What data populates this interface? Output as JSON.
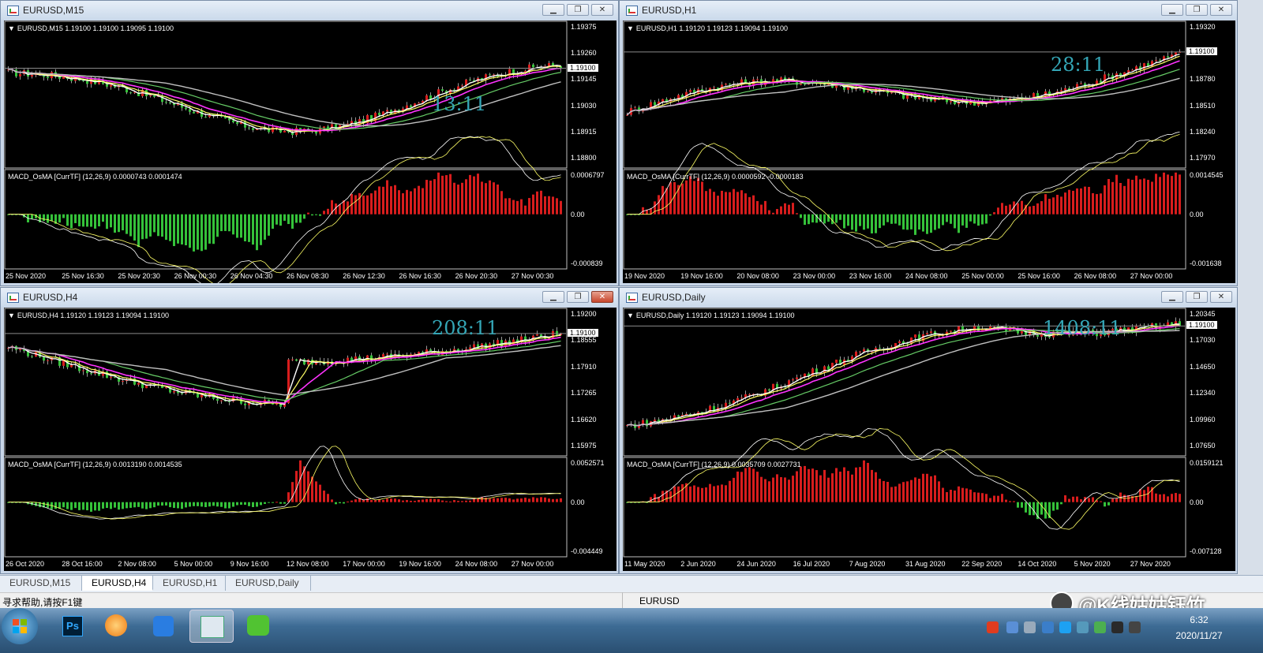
{
  "windows": [
    {
      "title": "EURUSD,M15",
      "header": "EURUSD,M15  1.19100 1.19100 1.19095 1.19100",
      "timer": "13:11",
      "price_labels": [
        "1.19375",
        "1.19260",
        "1.19145",
        "1.19030",
        "1.18915",
        "1.18800"
      ],
      "current": "1.19100",
      "indicator": "MACD_OsMA [CurrTF] (12,26,9) 0.0000743 0.0001474",
      "ind_top": "0.0006797",
      "ind_zero": "0.00",
      "ind_bottom": "-0.000839",
      "time_labels": [
        "25 Nov 2020",
        "25 Nov 16:30",
        "25 Nov 20:30",
        "26 Nov 00:30",
        "26 Nov 04:30",
        "26 Nov 08:30",
        "26 Nov 12:30",
        "26 Nov 16:30",
        "26 Nov 20:30",
        "27 Nov 00:30"
      ]
    },
    {
      "title": "EURUSD,H1",
      "header": "EURUSD,H1  1.19120 1.19123 1.19094 1.19100",
      "timer": "28:11",
      "price_labels": [
        "1.19320",
        "1.19050",
        "1.18780",
        "1.18510",
        "1.18240",
        "1.17970"
      ],
      "current": "1.19100",
      "indicator": "MACD_OsMA [CurrTF] (12,26,9) 0.0000592 -0.0000183",
      "ind_top": "0.0014545",
      "ind_zero": "0.00",
      "ind_bottom": "-0.001638",
      "time_labels": [
        "19 Nov 2020",
        "19 Nov 16:00",
        "20 Nov 08:00",
        "23 Nov 00:00",
        "23 Nov 16:00",
        "24 Nov 08:00",
        "25 Nov 00:00",
        "25 Nov 16:00",
        "26 Nov 08:00",
        "27 Nov 00:00"
      ]
    },
    {
      "title": "EURUSD,H4",
      "header": "EURUSD,H4  1.19120 1.19123 1.19094 1.19100",
      "timer": "208:11",
      "price_labels": [
        "1.19200",
        "1.18555",
        "1.17910",
        "1.17265",
        "1.16620",
        "1.15975"
      ],
      "current": "1.19100",
      "indicator": "MACD_OsMA [CurrTF] (12,26,9) 0.0013190 0.0014535",
      "ind_top": "0.0052571",
      "ind_zero": "0.00",
      "ind_bottom": "-0.004449",
      "time_labels": [
        "26 Oct 2020",
        "28 Oct 16:00",
        "2 Nov 08:00",
        "5 Nov 00:00",
        "9 Nov 16:00",
        "12 Nov 08:00",
        "17 Nov 00:00",
        "19 Nov 16:00",
        "24 Nov 08:00",
        "27 Nov 00:00"
      ]
    },
    {
      "title": "EURUSD,Daily",
      "header": "EURUSD,Daily  1.19120 1.19123 1.19094 1.19100",
      "timer": "1408:11",
      "price_labels": [
        "1.20345",
        "1.17030",
        "1.14650",
        "1.12340",
        "1.09960",
        "1.07650"
      ],
      "current": "1.19100",
      "indicator": "MACD_OsMA [CurrTF] (12,26,9) 0.0035709 0.0027731",
      "ind_top": "0.0159121",
      "ind_zero": "0.00",
      "ind_bottom": "-0.007128",
      "time_labels": [
        "11 May 2020",
        "2 Jun 2020",
        "24 Jun 2020",
        "16 Jul 2020",
        "7 Aug 2020",
        "31 Aug 2020",
        "22 Sep 2020",
        "14 Oct 2020",
        "5 Nov 2020",
        "27 Nov 2020"
      ]
    }
  ],
  "tabs": [
    "EURUSD,M15",
    "EURUSD,H4",
    "EURUSD,H1",
    "EURUSD,Daily"
  ],
  "status": {
    "help": "寻求帮助,请按F1键",
    "symbol": "EURUSD"
  },
  "watermark": "@K线姑姑钰竹",
  "clock": {
    "time": "6:32",
    "date": "2020/11/27"
  },
  "taskbar_apps": [
    "windows-start",
    "photoshop",
    "media-player",
    "app-cloud",
    "metatrader",
    "wechat"
  ]
}
